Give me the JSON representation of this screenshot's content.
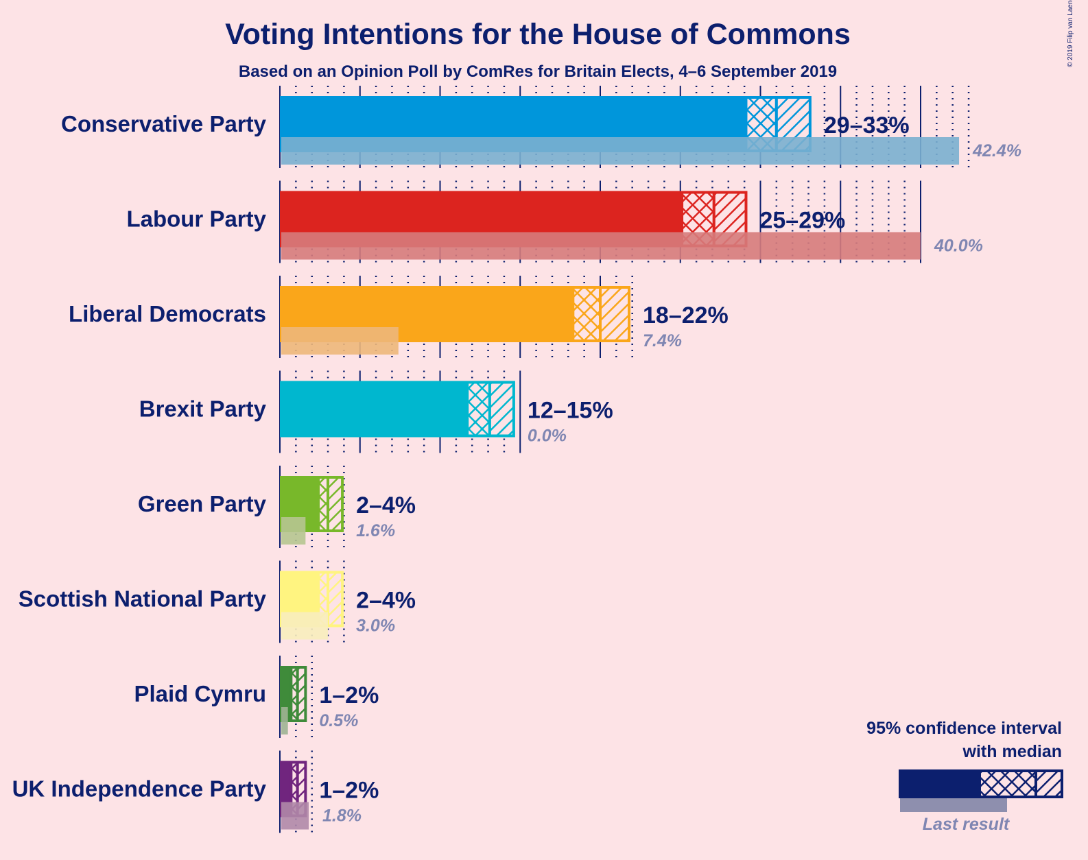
{
  "chart_data": {
    "type": "bar",
    "title": "Voting Intentions for the House of Commons",
    "subtitle": "Based on an Opinion Poll by ComRes for Britain Elects, 4–6 September 2019",
    "copyright": "© 2019 Filip van Laenen",
    "xlim": [
      0,
      43
    ],
    "unit": "%",
    "grid": "vertical, major every 5%, dotted minor every 1%",
    "categories": [
      "Conservative Party",
      "Labour Party",
      "Liberal Democrats",
      "Brexit Party",
      "Green Party",
      "Scottish National Party",
      "Plaid Cymru",
      "UK Independence Party"
    ],
    "series": [
      {
        "party": "Conservative Party",
        "color": "#0096DB",
        "last_color": "#7AAFCF",
        "ci_low": 29.1,
        "median": 31.0,
        "ci_high": 33.1,
        "range_label": "29–33%",
        "last_result": 42.4,
        "last_label": "42.4%"
      },
      {
        "party": "Labour Party",
        "color": "#DC241F",
        "last_color": "#D67B7B",
        "ci_low": 25.1,
        "median": 27.1,
        "ci_high": 29.1,
        "range_label": "25–29%",
        "last_result": 40.0,
        "last_label": "40.0%"
      },
      {
        "party": "Liberal Democrats",
        "color": "#FAA61A",
        "last_color": "#EDB77A",
        "ci_low": 18.3,
        "median": 20.0,
        "ci_high": 21.8,
        "range_label": "18–22%",
        "last_result": 7.4,
        "last_label": "7.4%"
      },
      {
        "party": "Brexit Party",
        "color": "#00B7CF",
        "last_color": "#7FCCD8",
        "ci_low": 11.7,
        "median": 13.1,
        "ci_high": 14.6,
        "range_label": "12–15%",
        "last_result": 0.0,
        "last_label": "0.0%"
      },
      {
        "party": "Green Party",
        "color": "#78B82A",
        "last_color": "#B6C590",
        "ci_low": 2.4,
        "median": 3.0,
        "ci_high": 3.9,
        "range_label": "2–4%",
        "last_result": 1.6,
        "last_label": "1.6%"
      },
      {
        "party": "Scottish National Party",
        "color": "#FFF480",
        "last_color": "#F8EDBC",
        "ci_low": 2.4,
        "median": 3.0,
        "ci_high": 3.9,
        "range_label": "2–4%",
        "last_result": 3.0,
        "last_label": "3.0%"
      },
      {
        "party": "Plaid Cymru",
        "color": "#3F8B3A",
        "last_color": "#9FB394",
        "ci_low": 0.7,
        "median": 1.1,
        "ci_high": 1.6,
        "range_label": "1–2%",
        "last_result": 0.5,
        "last_label": "0.5%"
      },
      {
        "party": "UK Independence Party",
        "color": "#70257E",
        "last_color": "#B088A8",
        "ci_low": 0.7,
        "median": 1.1,
        "ci_high": 1.6,
        "range_label": "1–2%",
        "last_result": 1.8,
        "last_label": "1.8%"
      }
    ],
    "legend": {
      "placement": "bottom-right",
      "line1": "95% confidence interval",
      "line2": "with median",
      "last_result": "Last result",
      "color": "#0C1F6E",
      "last_color": "#8E8FAE"
    }
  },
  "colors": {
    "background": "#FDE3E6",
    "text": "#0C1F6E",
    "grid": "#0C1F6E"
  }
}
